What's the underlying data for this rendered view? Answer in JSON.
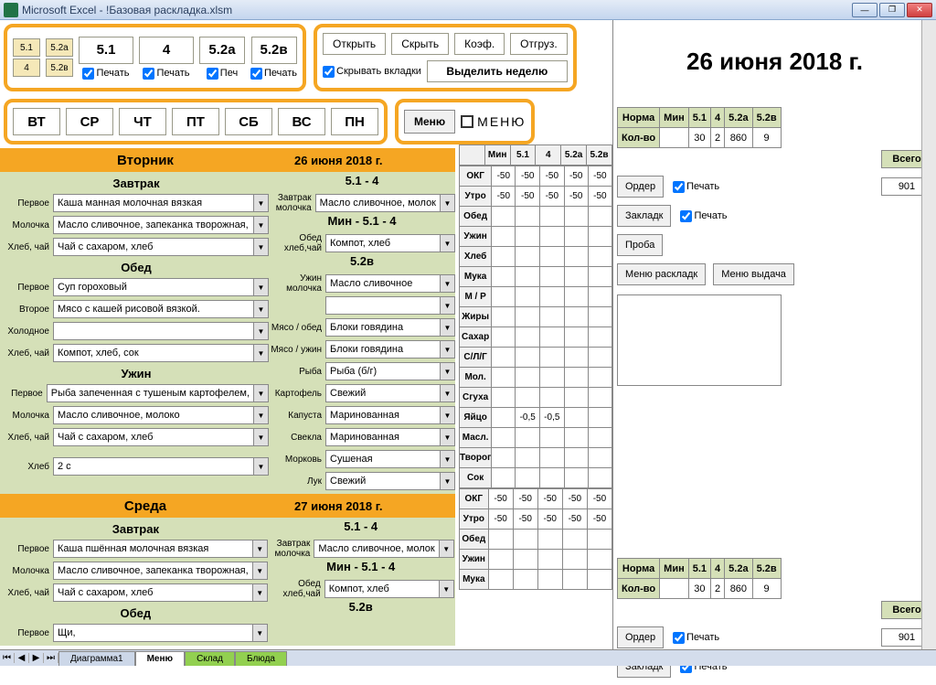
{
  "window": {
    "title": "Microsoft Excel - !Базовая раскладка.xlsm"
  },
  "topMini": [
    "5.1",
    "5.2а",
    "4",
    "5.2в"
  ],
  "topBig": [
    {
      "label": "5.1",
      "print": "Печать"
    },
    {
      "label": "4",
      "print": "Печать"
    },
    {
      "label": "5.2а",
      "print": "Печ"
    },
    {
      "label": "5.2в",
      "print": "Печать"
    }
  ],
  "actions1": {
    "open": "Открыть",
    "hide": "Скрыть",
    "coef": "Коэф.",
    "ship": "Отгруз.",
    "hideTabs": "Скрывать вкладки",
    "selectWeek": "Выделить неделю"
  },
  "days": [
    "ВТ",
    "СР",
    "ЧТ",
    "ПТ",
    "СБ",
    "ВС",
    "ПН"
  ],
  "menuBtn": "Меню",
  "menuLabel": "МЕНЮ",
  "gridHeader": {
    "min": "Мин",
    "c1": "5.1",
    "c2": "4",
    "c3": "5.2а",
    "c4": "5.2в"
  },
  "gridRows": [
    {
      "l": "ОКГ",
      "v": [
        "-50",
        "-50",
        "-50",
        "-50",
        "-50"
      ]
    },
    {
      "l": "Утро",
      "v": [
        "-50",
        "-50",
        "-50",
        "-50",
        "-50"
      ]
    },
    {
      "l": "Обед",
      "v": [
        "",
        "",
        "",
        "",
        ""
      ]
    },
    {
      "l": "Ужин",
      "v": [
        "",
        "",
        "",
        "",
        ""
      ]
    },
    {
      "l": "Хлеб",
      "v": [
        "",
        "",
        "",
        "",
        ""
      ]
    },
    {
      "l": "Мука",
      "v": [
        "",
        "",
        "",
        "",
        ""
      ]
    },
    {
      "l": "М / Р",
      "v": [
        "",
        "",
        "",
        "",
        ""
      ]
    },
    {
      "l": "Жиры",
      "v": [
        "",
        "",
        "",
        "",
        ""
      ]
    },
    {
      "l": "Сахар",
      "v": [
        "",
        "",
        "",
        "",
        ""
      ]
    },
    {
      "l": "С/Л/Г",
      "v": [
        "",
        "",
        "",
        "",
        ""
      ]
    },
    {
      "l": "Мол.",
      "v": [
        "",
        "",
        "",
        "",
        ""
      ]
    },
    {
      "l": "Сгуха",
      "v": [
        "",
        "",
        "",
        "",
        ""
      ]
    },
    {
      "l": "Яйцо",
      "v": [
        "",
        "-0,5",
        "-0,5",
        "",
        ""
      ]
    },
    {
      "l": "Масл.",
      "v": [
        "",
        "",
        "",
        "",
        ""
      ]
    },
    {
      "l": "Творог",
      "v": [
        "",
        "",
        "",
        "",
        ""
      ]
    },
    {
      "l": "Сок",
      "v": [
        "",
        "",
        "",
        "",
        ""
      ]
    }
  ],
  "bigDate": "26 июня 2018 г.",
  "norma": {
    "hdr": [
      "Норма",
      "Мин",
      "5.1",
      "4",
      "5.2а",
      "5.2в"
    ],
    "row": [
      "Кол-во",
      "",
      "30",
      "2",
      "860",
      "9"
    ],
    "vsego": "Всего",
    "vval": "901"
  },
  "rightBtns": {
    "order": "Ордер",
    "print": "Печать",
    "zaklad": "Закладк",
    "proba": "Проба",
    "menuRaskl": "Меню раскладк",
    "menuVyd": "Меню выдача"
  },
  "daysData": [
    {
      "name": "Вторник",
      "date": "26 июня 2018 г.",
      "left": {
        "zavtrak": "Завтрак",
        "rows1": [
          {
            "l": "Первое",
            "v": "Каша манная молочная вязкая"
          },
          {
            "l": "Молочка",
            "v": "Масло сливочное, запеканка творожная,"
          },
          {
            "l": "Хлеб, чай",
            "v": "Чай с сахаром, хлеб"
          }
        ],
        "obed": "Обед",
        "rows2": [
          {
            "l": "Первое",
            "v": "Суп гороховый"
          },
          {
            "l": "Второе",
            "v": "Мясо с кашей рисовой вязкой."
          },
          {
            "l": "Холодное",
            "v": ""
          },
          {
            "l": "Хлеб, чай",
            "v": "Компот, хлеб, сок"
          }
        ],
        "uzhin": "Ужин",
        "rows3": [
          {
            "l": "Первое",
            "v": "Рыба запеченная с тушеным картофелем,"
          },
          {
            "l": "Молочка",
            "v": "Масло сливочное, молоко"
          },
          {
            "l": "Хлеб, чай",
            "v": "Чай с сахаром, хлеб"
          }
        ],
        "hleb": {
          "l": "Хлеб",
          "v": "2 с"
        }
      },
      "right": {
        "title1": "5.1 - 4",
        "r1": [
          {
            "l": "Завтрак молочка",
            "v": "Масло сливочное, молок"
          }
        ],
        "title2": "Мин - 5.1 - 4",
        "r2": [
          {
            "l": "Обед хлеб,чай",
            "v": "Компот, хлеб"
          }
        ],
        "title3": "5.2в",
        "r3": [
          {
            "l": "Ужин молочка",
            "v": "Масло сливочное"
          },
          {
            "l": "",
            "v": ""
          },
          {
            "l": "Мясо / обед",
            "v": "Блоки говядина"
          },
          {
            "l": "Мясо / ужин",
            "v": "Блоки говядина"
          },
          {
            "l": "Рыба",
            "v": "Рыба (б/г)"
          },
          {
            "l": "Картофель",
            "v": "Свежий"
          },
          {
            "l": "Капуста",
            "v": "Маринованная"
          },
          {
            "l": "Свекла",
            "v": "Маринованная"
          },
          {
            "l": "Морковь",
            "v": "Сушеная"
          },
          {
            "l": "Лук",
            "v": "Свежий"
          }
        ]
      }
    },
    {
      "name": "Среда",
      "date": "27 июня 2018 г.",
      "left": {
        "zavtrak": "Завтрак",
        "rows1": [
          {
            "l": "Первое",
            "v": "Каша пшённая молочная вязкая"
          },
          {
            "l": "Молочка",
            "v": "Масло сливочное, запеканка творожная,"
          },
          {
            "l": "Хлеб, чай",
            "v": "Чай с сахаром, хлеб"
          }
        ],
        "obed": "Обед",
        "rows2": [
          {
            "l": "Первое",
            "v": "Щи,"
          }
        ]
      },
      "right": {
        "title1": "5.1 - 4",
        "r1": [
          {
            "l": "Завтрак молочка",
            "v": "Масло сливочное, молок"
          }
        ],
        "title2": "Мин - 5.1 - 4",
        "r2": [
          {
            "l": "Обед хлеб,чай",
            "v": "Компот, хлеб"
          }
        ],
        "title3": "5.2в"
      }
    }
  ],
  "tabs": [
    "Диаграмма1",
    "Меню",
    "Склад",
    "Блюда"
  ],
  "gridRows2": [
    {
      "l": "ОКГ",
      "v": [
        "-50",
        "-50",
        "-50",
        "-50",
        "-50"
      ]
    },
    {
      "l": "Утро",
      "v": [
        "-50",
        "-50",
        "-50",
        "-50",
        "-50"
      ]
    },
    {
      "l": "Обед",
      "v": [
        "",
        "",
        "",
        "",
        ""
      ]
    },
    {
      "l": "Ужин",
      "v": [
        "",
        "",
        "",
        "",
        ""
      ]
    },
    {
      "l": "Мука",
      "v": [
        "",
        "",
        "",
        "",
        ""
      ]
    }
  ]
}
